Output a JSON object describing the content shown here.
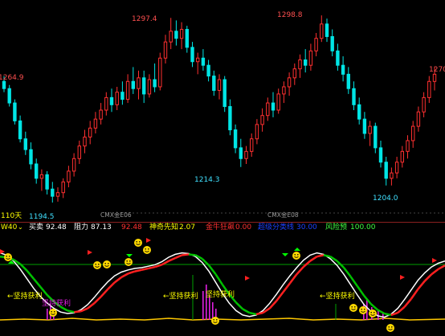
{
  "colors": {
    "background": "#000000",
    "up_candle": "#ff3030",
    "down_candle": "#00e5e5",
    "price_label": "#ff5050",
    "low_label": "#40e0ff",
    "info_white": "#ffffff",
    "info_red": "#ff3030",
    "info_yellow": "#ffff00",
    "info_blue": "#1e40ff",
    "info_green": "#40ff40",
    "osc_white": "#ffffff",
    "osc_green": "#00c000",
    "osc_red": "#ff2020",
    "baseline_yellow": "#ffc800",
    "guide_green": "#00a000",
    "magenta": "#e020e0"
  },
  "top_panel": {
    "range_label": "110天",
    "gridline_labels": [
      "CMX金E06",
      "CMX金E08"
    ]
  },
  "indicator_bar": {
    "title": "W40",
    "items": [
      {
        "label": "买卖",
        "value": "92.48"
      },
      {
        "label": "阻力",
        "value": "87.13"
      },
      {
        "label": "",
        "value": "92.48"
      },
      {
        "label": "神奇先知",
        "value": "2.07"
      },
      {
        "label": "金牛狂飙",
        "value": "0.00"
      },
      {
        "label": "超级分类线",
        "value": "30.00"
      },
      {
        "label": "风险预",
        "value": "100.00"
      }
    ]
  },
  "oscillator": {
    "signal_labels": [
      "坚持获利",
      "坚持获利",
      "坚持获利",
      "坚持获利",
      "坚持获利"
    ]
  },
  "chart_data": [
    {
      "type": "candlestick",
      "title": "",
      "price_labels": [
        "1264.9",
        "1297.4",
        "1298.8",
        "1270",
        "1214.3",
        "1194.5",
        "1204.0"
      ],
      "extremes": [
        {
          "kind": "high",
          "value": 1297.4
        },
        {
          "kind": "high",
          "value": 1298.8
        },
        {
          "kind": "low",
          "value": 1194.5
        },
        {
          "kind": "low",
          "value": 1214.3
        },
        {
          "kind": "low",
          "value": 1204.0
        }
      ],
      "ylim": [
        1190,
        1302
      ],
      "candles": [
        [
          1262,
          1265,
          1256,
          1258
        ],
        [
          1258,
          1260,
          1248,
          1250
        ],
        [
          1250,
          1252,
          1238,
          1240
        ],
        [
          1240,
          1243,
          1228,
          1230
        ],
        [
          1230,
          1234,
          1221,
          1224
        ],
        [
          1224,
          1228,
          1213,
          1216
        ],
        [
          1216,
          1219,
          1205,
          1208
        ],
        [
          1208,
          1213,
          1201,
          1210
        ],
        [
          1210,
          1212,
          1199,
          1202
        ],
        [
          1202,
          1206,
          1194.5,
          1198
        ],
        [
          1198,
          1203,
          1195,
          1200
        ],
        [
          1200,
          1208,
          1197,
          1206
        ],
        [
          1206,
          1215,
          1203,
          1212
        ],
        [
          1212,
          1222,
          1209,
          1219
        ],
        [
          1219,
          1229,
          1216,
          1226
        ],
        [
          1226,
          1235,
          1222,
          1231
        ],
        [
          1231,
          1240,
          1227,
          1236
        ],
        [
          1236,
          1245,
          1233,
          1241
        ],
        [
          1241,
          1250,
          1238,
          1246
        ],
        [
          1246,
          1256,
          1243,
          1253
        ],
        [
          1253,
          1258,
          1245,
          1249
        ],
        [
          1249,
          1259,
          1246,
          1256
        ],
        [
          1256,
          1262,
          1249,
          1252
        ],
        [
          1252,
          1266,
          1250,
          1262
        ],
        [
          1262,
          1270,
          1255,
          1258
        ],
        [
          1258,
          1268,
          1252,
          1264
        ],
        [
          1264,
          1268,
          1250,
          1255
        ],
        [
          1255,
          1266,
          1253,
          1263
        ],
        [
          1263,
          1272,
          1256,
          1259
        ],
        [
          1259,
          1278,
          1257,
          1275
        ],
        [
          1275,
          1288,
          1272,
          1284
        ],
        [
          1284,
          1297.4,
          1280,
          1290
        ],
        [
          1290,
          1296,
          1282,
          1286
        ],
        [
          1286,
          1295,
          1280,
          1291
        ],
        [
          1291,
          1293,
          1278,
          1281
        ],
        [
          1281,
          1284,
          1270,
          1273
        ],
        [
          1273,
          1278,
          1266,
          1275
        ],
        [
          1275,
          1280,
          1268,
          1271
        ],
        [
          1271,
          1274,
          1262,
          1265
        ],
        [
          1265,
          1268,
          1254,
          1257
        ],
        [
          1257,
          1266,
          1252,
          1263
        ],
        [
          1263,
          1265,
          1245,
          1248
        ],
        [
          1248,
          1252,
          1232,
          1235
        ],
        [
          1235,
          1238,
          1222,
          1225
        ],
        [
          1225,
          1230,
          1214.3,
          1219
        ],
        [
          1219,
          1226,
          1216,
          1223
        ],
        [
          1223,
          1233,
          1220,
          1230
        ],
        [
          1230,
          1241,
          1227,
          1238
        ],
        [
          1238,
          1247,
          1234,
          1243
        ],
        [
          1243,
          1253,
          1240,
          1250
        ],
        [
          1250,
          1256,
          1242,
          1246
        ],
        [
          1246,
          1258,
          1244,
          1255
        ],
        [
          1255,
          1262,
          1250,
          1259
        ],
        [
          1259,
          1267,
          1254,
          1264
        ],
        [
          1264,
          1272,
          1260,
          1269
        ],
        [
          1269,
          1277,
          1264,
          1274
        ],
        [
          1274,
          1280,
          1267,
          1271
        ],
        [
          1271,
          1283,
          1268,
          1279
        ],
        [
          1279,
          1289,
          1276,
          1286
        ],
        [
          1286,
          1298.8,
          1284,
          1294
        ],
        [
          1294,
          1297,
          1284,
          1287
        ],
        [
          1287,
          1291,
          1276,
          1279
        ],
        [
          1279,
          1283,
          1268,
          1271
        ],
        [
          1271,
          1276,
          1262,
          1266
        ],
        [
          1266,
          1270,
          1255,
          1258
        ],
        [
          1258,
          1262,
          1246,
          1249
        ],
        [
          1249,
          1253,
          1238,
          1241
        ],
        [
          1241,
          1245,
          1230,
          1233
        ],
        [
          1233,
          1240,
          1226,
          1237
        ],
        [
          1237,
          1239,
          1222,
          1225
        ],
        [
          1225,
          1229,
          1214,
          1217
        ],
        [
          1217,
          1220,
          1204,
          1208
        ],
        [
          1208,
          1214,
          1204,
          1211
        ],
        [
          1211,
          1220,
          1208,
          1217
        ],
        [
          1217,
          1226,
          1214,
          1223
        ],
        [
          1223,
          1232,
          1219,
          1229
        ],
        [
          1229,
          1240,
          1225,
          1237
        ],
        [
          1237,
          1248,
          1234,
          1245
        ],
        [
          1245,
          1256,
          1242,
          1253
        ],
        [
          1253,
          1265,
          1250,
          1262
        ],
        [
          1262,
          1270,
          1257,
          1266
        ]
      ]
    },
    {
      "type": "line",
      "title": "W40 oscillator",
      "ylim": [
        0,
        100
      ],
      "series": [
        {
          "name": "买卖",
          "values": [
            95,
            92,
            84,
            73,
            60,
            47,
            36,
            27,
            20,
            15,
            13,
            14,
            18,
            25,
            35,
            46,
            56,
            64,
            69,
            72,
            74,
            75,
            77,
            79,
            83,
            89,
            93,
            95,
            94,
            90,
            82,
            70,
            55,
            40,
            27,
            17,
            11,
            9,
            11,
            17,
            27,
            39,
            52,
            64,
            75,
            85,
            92,
            95,
            93,
            87,
            78,
            66,
            52,
            38,
            25,
            16,
            10,
            8,
            12,
            20,
            32,
            45,
            58,
            68,
            76,
            81,
            84
          ]
        },
        {
          "name": "阻力",
          "values": [
            90,
            89,
            86,
            80,
            71,
            60,
            49,
            38,
            29,
            22,
            17,
            15,
            16,
            20,
            27,
            36,
            46,
            55,
            62,
            67,
            70,
            72,
            74,
            76,
            79,
            84,
            88,
            92,
            93,
            92,
            87,
            78,
            66,
            52,
            39,
            28,
            19,
            14,
            12,
            14,
            20,
            30,
            42,
            54,
            66,
            76,
            84,
            90,
            92,
            90,
            84,
            75,
            63,
            50,
            37,
            26,
            18,
            13,
            11,
            14,
            22,
            33,
            46,
            57,
            66,
            73,
            78
          ]
        }
      ]
    }
  ]
}
